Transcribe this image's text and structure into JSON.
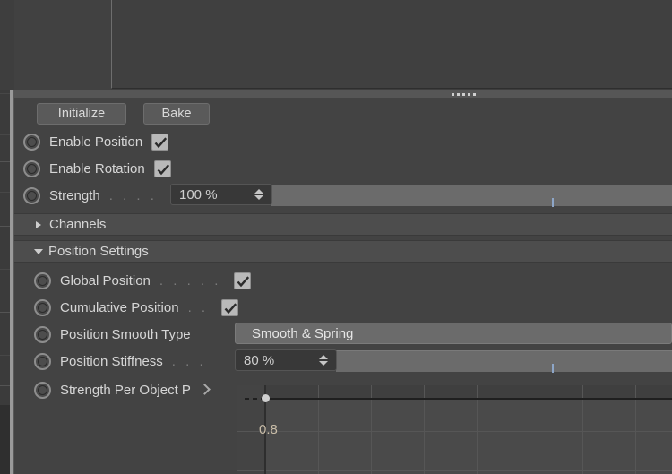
{
  "app": {
    "panel_name": "attribute-manager",
    "theme_bg": "#434343",
    "accent": "#8da6c8"
  },
  "toolbar": {
    "initialize_label": "Initialize",
    "bake_label": "Bake"
  },
  "rows": [
    {
      "name": "enable-position",
      "label": "Enable Position",
      "control": "checkbox",
      "checked": true,
      "dots": ""
    },
    {
      "name": "enable-rotation",
      "label": "Enable Rotation",
      "control": "checkbox",
      "checked": true,
      "dots": ""
    },
    {
      "name": "strength",
      "label": "Strength",
      "control": "number-slider",
      "value": "100 %",
      "dots": ". . . ."
    }
  ],
  "sections": [
    {
      "name": "channels",
      "label": "Channels",
      "expanded": false,
      "arrow": "triangle-right-icon"
    },
    {
      "name": "position-settings",
      "label": "Position Settings",
      "expanded": true,
      "arrow": "triangle-down-icon"
    }
  ],
  "position_settings": {
    "global_position": {
      "label": "Global Position",
      "dots": ". . . . .",
      "control": "checkbox",
      "checked": true
    },
    "cumulative_position": {
      "label": "Cumulative Position",
      "dots": ". .",
      "control": "checkbox",
      "checked": true
    },
    "position_smooth_type": {
      "label": "Position Smooth Type",
      "control": "dropdown",
      "value": "Smooth & Spring"
    },
    "position_stiffness": {
      "label": "Position Stiffness",
      "dots": ". . .",
      "control": "number-slider",
      "value": "80 %"
    },
    "strength_per_object": {
      "label": "Strength Per Object P",
      "control": "expander",
      "arrow": "chevron-right-icon"
    }
  },
  "graph": {
    "name": "spline-curve-editor",
    "y_axis_label": "0.8",
    "curve_value": 1.0,
    "knot_count": 1,
    "grid": true
  }
}
